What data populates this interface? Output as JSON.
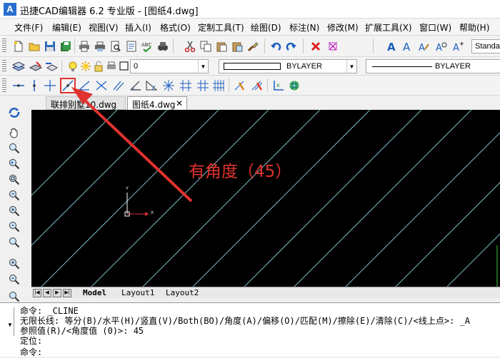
{
  "titlebar": {
    "app_icon": "A",
    "title": "迅捷CAD编辑器 6.2 专业版 - [图纸4.dwg]"
  },
  "menu": [
    "文件(F)",
    "编辑(E)",
    "视图(V)",
    "插入(I)",
    "格式(O)",
    "定制工具(T)",
    "绘图(D)",
    "标注(N)",
    "修改(M)",
    "扩展工具(X)",
    "窗口(W)",
    "帮助(H)"
  ],
  "toolbar1": {
    "style_combo": "Standa"
  },
  "toolbar2": {
    "layer_value": "0",
    "color_value": "BYLAYER",
    "linetype_value": "BYLAYER"
  },
  "tabs": [
    {
      "label": "联排别墅10.dwg"
    },
    {
      "label": "图纸4.dwg"
    }
  ],
  "ucs": {
    "y_label": "Y",
    "x_label": "X"
  },
  "annotation": {
    "text": "有角度（45）",
    "color": "#e0322f"
  },
  "layout_tabs": [
    "Model",
    "Layout1",
    "Layout2"
  ],
  "command": {
    "line1": "命令:   _CLINE",
    "line2": "无限长线:  等分(B)/水平(H)/竖直(V)/Both(BO)/角度(A)/偏移(O)/匹配(M)/擦除(E)/清除(C)/<线上点>: _A",
    "line3": "参照值(R)/<角度值 (0)>: 45",
    "line4": "定位:",
    "line5": "命令:"
  },
  "colors": {
    "canvas_bg": "#000000",
    "construction_line": "#7fb7c8",
    "highlight": "#e0322f"
  }
}
